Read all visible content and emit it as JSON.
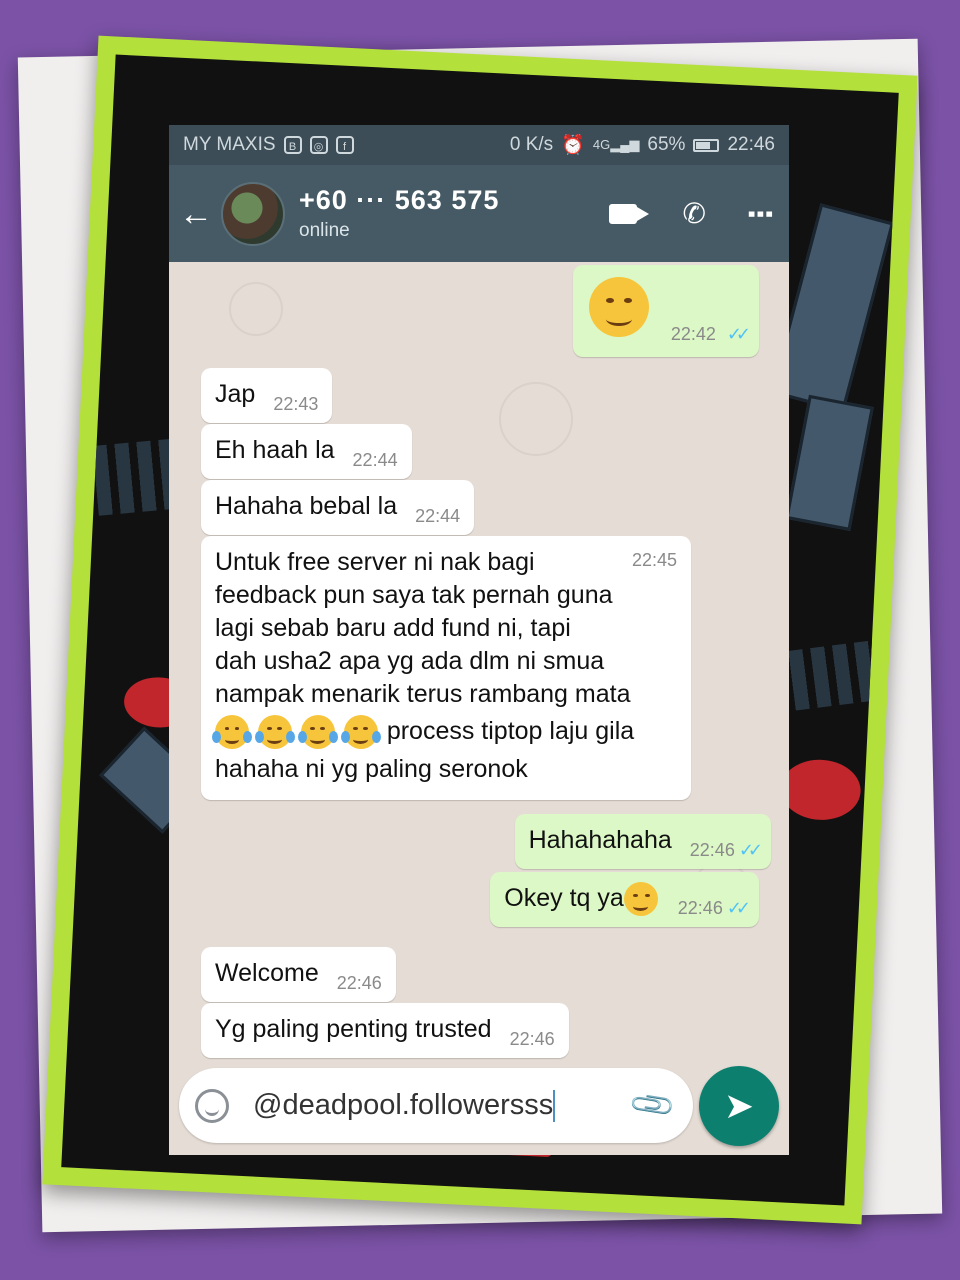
{
  "status_bar": {
    "carrier": "MY MAXIS",
    "net_speed": "0 K/s",
    "network": "4G",
    "battery": "65%",
    "time": "22:46"
  },
  "header": {
    "contact_name": "+60 ··· 563 575",
    "contact_status": "online",
    "icons": [
      "back-arrow-icon",
      "video-call-icon",
      "phone-call-icon",
      "more-options-icon"
    ]
  },
  "messages": [
    {
      "dir": "out",
      "text": "",
      "emoji": "yum",
      "time": "22:42",
      "read": true
    },
    {
      "dir": "in",
      "text": "Jap",
      "time": "22:43"
    },
    {
      "dir": "in",
      "text": "Eh haah la",
      "time": "22:44"
    },
    {
      "dir": "in",
      "text": "Hahaha bebal la",
      "time": "22:44"
    },
    {
      "dir": "in",
      "lines": [
        "Untuk free server ni nak bagi",
        "feedback pun saya tak pernah guna",
        "lagi sebab baru add fund ni, tapi",
        "dah usha2 apa yg ada dlm ni smua",
        "nampak menarik terus rambang mata"
      ],
      "laugh_count": 4,
      "after_emoji": " process tiptop laju gila",
      "last_line": "hahaha ni yg paling seronok",
      "time": "22:45"
    },
    {
      "dir": "out",
      "text": "Hahahahaha",
      "time": "22:46",
      "read": true
    },
    {
      "dir": "out",
      "text": "Okey tq ya",
      "emoji": "yum",
      "time": "22:46",
      "read": true
    },
    {
      "dir": "in",
      "text": "Welcome",
      "time": "22:46"
    },
    {
      "dir": "in",
      "text": "Yg paling penting trusted",
      "time": "22:46"
    }
  ],
  "composer": {
    "value": "@deadpool.followersss"
  },
  "colors": {
    "appbar": "#455a64",
    "outgoing_bubble": "#dcf8c6",
    "incoming_bubble": "#ffffff",
    "send_button": "#0d7f6f",
    "frame": "#b4e03c",
    "background": "#7b52a6"
  }
}
